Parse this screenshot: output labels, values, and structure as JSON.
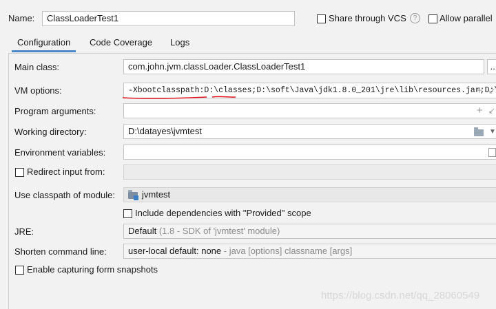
{
  "name": {
    "label": "Name:",
    "value": "ClassLoaderTest1",
    "share_label": "Share through VCS",
    "help_glyph": "?",
    "allow_parallel_label": "Allow parallel"
  },
  "tabs": [
    {
      "label": "Configuration",
      "active": true
    },
    {
      "label": "Code Coverage",
      "active": false
    },
    {
      "label": "Logs",
      "active": false
    }
  ],
  "form": {
    "main_class": {
      "label": "Main class:",
      "value": "com.john.jvm.classLoader.ClassLoaderTest1",
      "browse": "..."
    },
    "vm_options": {
      "label": "VM options:",
      "value": "-Xbootclasspath:D:\\classes;D:\\soft\\Java\\jdk1.8.0_201\\jre\\lib\\resources.jar;D:\\soft\\",
      "expand": "+"
    },
    "program_arguments": {
      "label": "Program arguments:",
      "value": "",
      "expand": "+"
    },
    "working_directory": {
      "label": "Working directory:",
      "value": "D:\\datayes\\jvmtest"
    },
    "environment_variables": {
      "label": "Environment variables:",
      "value": ""
    },
    "redirect_input": {
      "label": "Redirect input from:",
      "value": ""
    },
    "classpath_module": {
      "label": "Use classpath of module:",
      "value": "jvmtest"
    },
    "include_provided": {
      "label": "Include dependencies with \"Provided\" scope"
    },
    "jre": {
      "label": "JRE:",
      "value": "Default",
      "hint": "(1.8 - SDK of 'jvmtest' module)"
    },
    "shorten_cmd": {
      "label": "Shorten command line:",
      "value": "user-local default: none",
      "hint": "- java [options] classname [args]"
    },
    "capture_snapshots": {
      "label": "Enable capturing form snapshots"
    }
  },
  "watermark": "https://blog.csdn.net/qq_28060549",
  "colors": {
    "tab_underline": "#4a88c7",
    "annotation": "#e0141e"
  }
}
